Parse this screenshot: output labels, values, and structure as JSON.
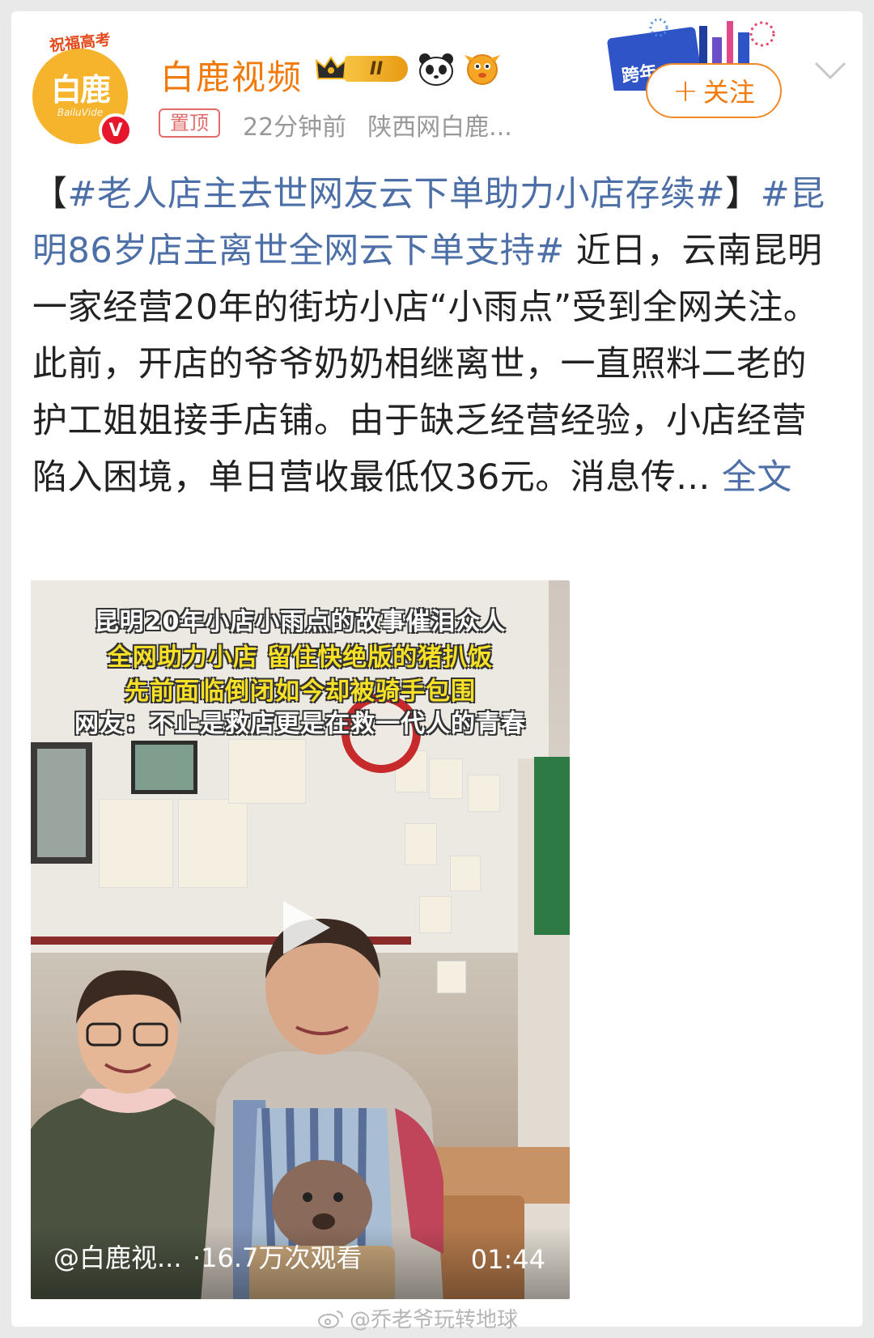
{
  "header": {
    "avatar_banner": "祝福高考",
    "avatar_logo": "白鹿",
    "avatar_logo_sub": "BailuVide",
    "verified_mark": "V",
    "username": "白鹿视频",
    "level_badge": "II",
    "pinned_label": "置顶",
    "time_ago": "22分钟前",
    "source": "陕西网白鹿...",
    "follow_label": "关注",
    "follow_plus": "+",
    "promo_text": "跨年"
  },
  "post": {
    "bracket_open": "【",
    "tag1": "#老人店主去世网友云下单助力小店存续#",
    "bracket_close": "】",
    "tag2": "#昆明86岁店主离世全网云下单支持#",
    "body": " 近日，云南昆明一家经营20年的街坊小店“小雨点”受到全网关注。此前，开店的爷爷奶奶相继离世，一直照料二老的护工姐姐接手店铺。由于缺乏经营经验，小店经营陷入困境，单日营收最低仅36元。消息传... ",
    "full_text_link": "全文"
  },
  "video": {
    "caption_line1": "昆明20年小店小雨点的故事催泪众人",
    "caption_line2": "全网助力小店 留住快绝版的猪扒饭",
    "caption_line3": "先前面临倒闭如今却被骑手包围",
    "caption_line4": "网友：不止是救店更是在救一代人的青春",
    "author": "@白鹿视...",
    "views": "·16.7万次观看",
    "duration": "01:44"
  },
  "watermark": "@乔老爷玩转地球",
  "colors": {
    "accent_orange": "#f07a0c",
    "link_blue": "#4d6fa8",
    "verified_red": "#e6162d"
  }
}
